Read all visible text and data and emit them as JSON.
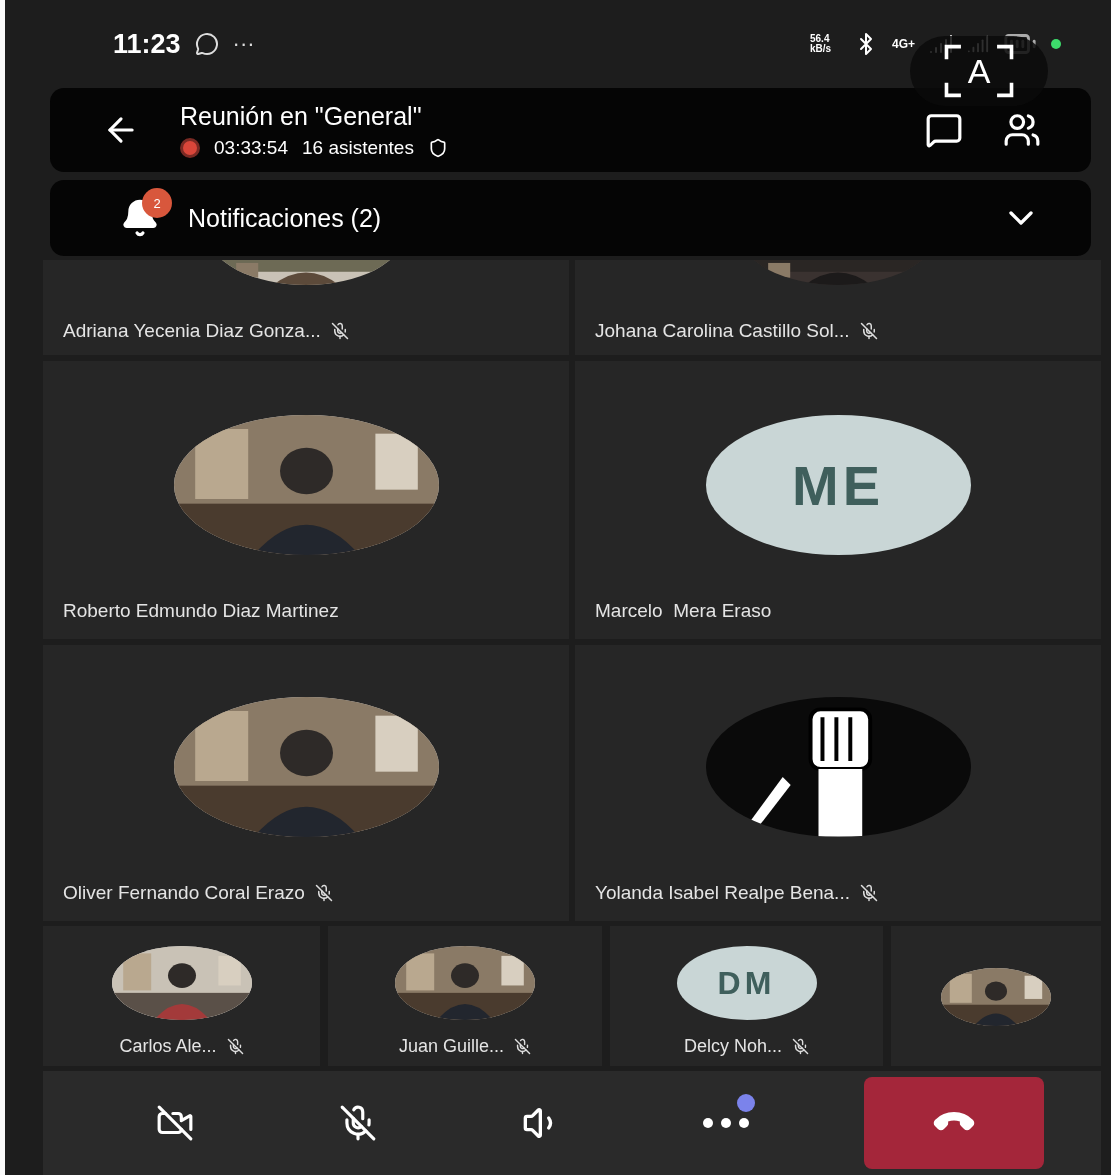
{
  "status_bar": {
    "time": "11:23",
    "more": "···",
    "speed": "56.4 kB/s",
    "network": "4G+"
  },
  "translate_button": {
    "label": "A"
  },
  "header": {
    "title": "Reunión en \"General\"",
    "recording": true,
    "duration": "03:33:54",
    "attendees": "16 asistentes"
  },
  "notifications": {
    "label": "Notificaciones (2)",
    "badge": "2"
  },
  "participant_rows": [
    {
      "tiles": [
        {
          "name": "Adriana Yecenia Diaz Gonza...",
          "muted": true
        },
        {
          "name": "Johana Carolina Castillo Sol...",
          "muted": true
        }
      ]
    },
    {
      "tiles": [
        {
          "name": "Roberto Edmundo Diaz Martinez",
          "muted": false
        },
        {
          "name": "Marcelo  Mera Eraso",
          "muted": false,
          "avatar": {
            "kind": "initials",
            "initials": "ME"
          }
        }
      ]
    },
    {
      "tiles": [
        {
          "name": "Oliver Fernando Coral Erazo",
          "muted": true
        },
        {
          "name": "Yolanda Isabel Realpe Bena...",
          "muted": true,
          "avatar": {
            "kind": "fist"
          }
        }
      ]
    }
  ],
  "small_participants": [
    {
      "name": "Carlos Ale...",
      "muted": true
    },
    {
      "name": "Juan Guille...",
      "muted": true
    },
    {
      "name": "Delcy Noh...",
      "muted": true,
      "avatar": {
        "kind": "initials",
        "initials": "DM"
      }
    },
    {
      "muted": false
    }
  ],
  "controls": {
    "camera_on": false,
    "mic_on": false,
    "more_badge": true
  }
}
